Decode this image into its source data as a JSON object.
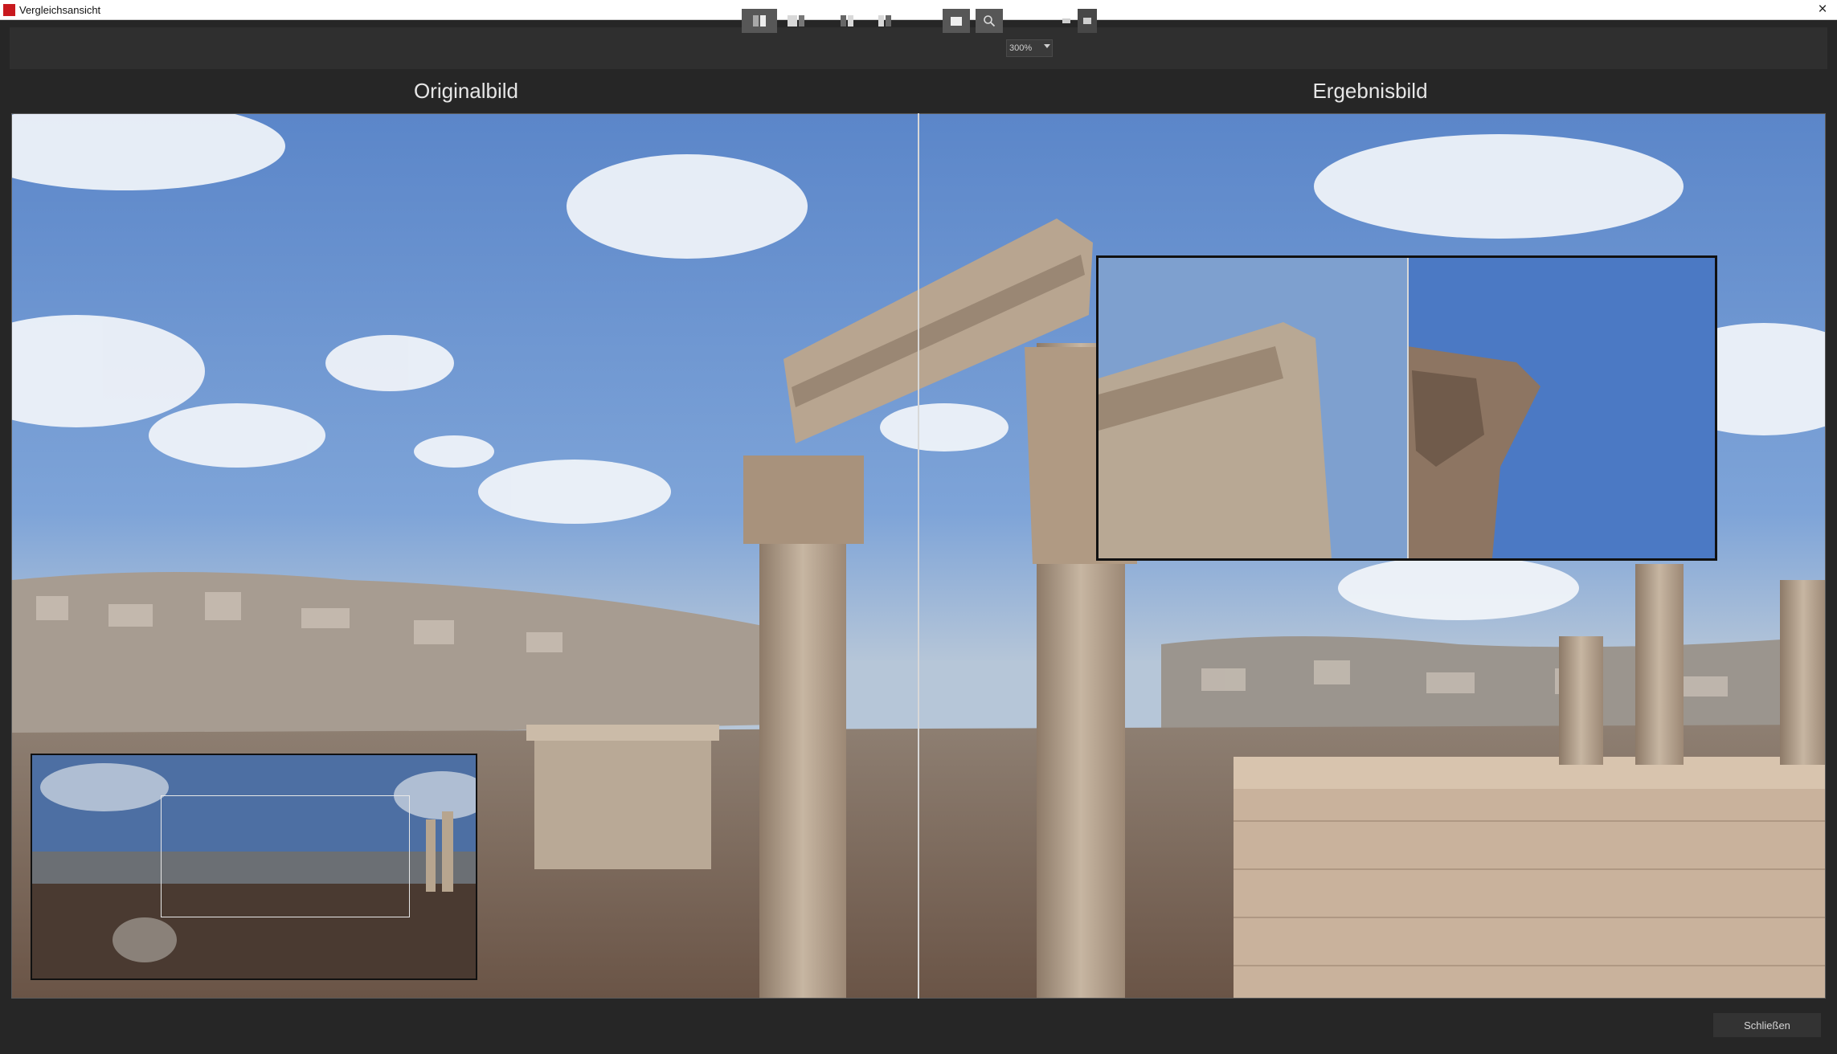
{
  "window": {
    "title": "Vergleichsansicht",
    "close_icon": "×"
  },
  "toolbar": {
    "buttons": [
      {
        "name": "view-side-by-side",
        "icon": "split-view-icon",
        "active": true
      },
      {
        "name": "view-single",
        "icon": "single-view-icon",
        "active": false
      },
      {
        "name": "view-split-left",
        "icon": "split-left-icon",
        "active": false
      },
      {
        "name": "view-split-right",
        "icon": "split-right-icon",
        "active": false
      },
      {
        "name": "navigator-toggle",
        "icon": "navigator-icon",
        "active": true
      },
      {
        "name": "loupe-toggle",
        "icon": "magnifier-icon",
        "active": true
      }
    ],
    "zoom_value": "300%"
  },
  "panels": {
    "left_title": "Originalbild",
    "right_title": "Ergebnisbild"
  },
  "footer": {
    "close_label": "Schließen"
  },
  "colors": {
    "accent_brand": "#c8191e",
    "window_bg": "#262626",
    "toolbar_bg": "#2f2f2f"
  }
}
